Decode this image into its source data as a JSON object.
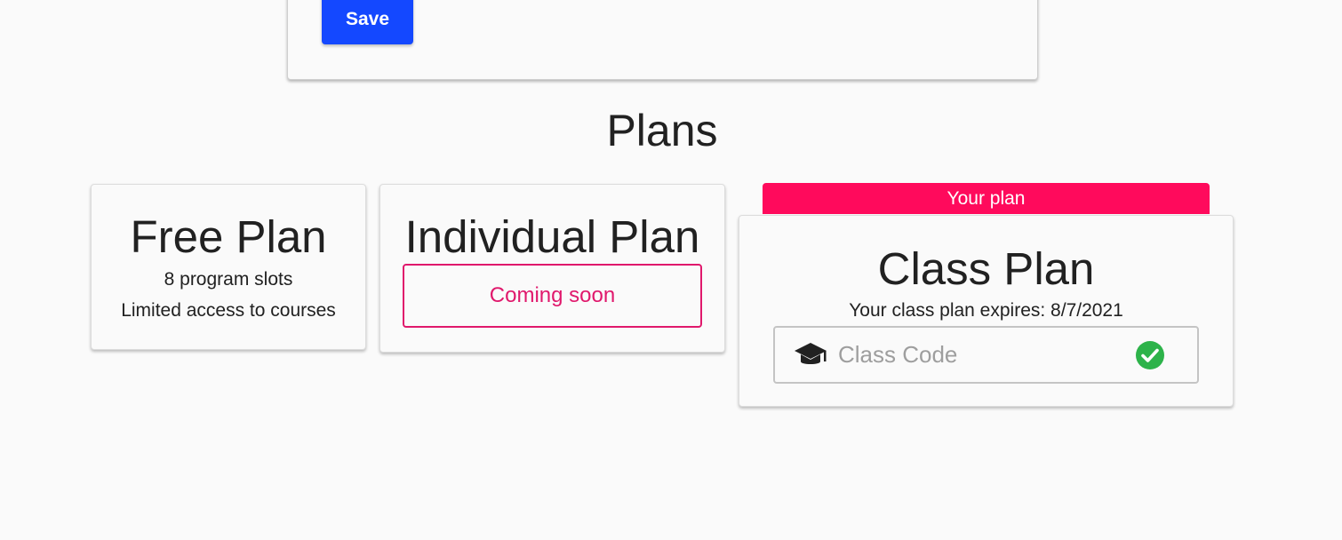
{
  "account": {
    "save_label": "Save"
  },
  "plans": {
    "title": "Plans",
    "free": {
      "name": "Free Plan",
      "slots": "8 program slots",
      "access": "Limited access to courses"
    },
    "individual": {
      "name": "Individual Plan",
      "status": "Coming soon"
    },
    "class": {
      "badge": "Your plan",
      "name": "Class Plan",
      "expires": "Your class plan expires: 8/7/2021",
      "code_placeholder": "Class Code",
      "code_icon": "graduation-cap-icon",
      "valid_icon": "check-circle-icon"
    }
  },
  "colors": {
    "primary": "#1448ff",
    "accent": "#ff0a5c",
    "accent_outline": "#e0186c",
    "success": "#2db34a"
  }
}
